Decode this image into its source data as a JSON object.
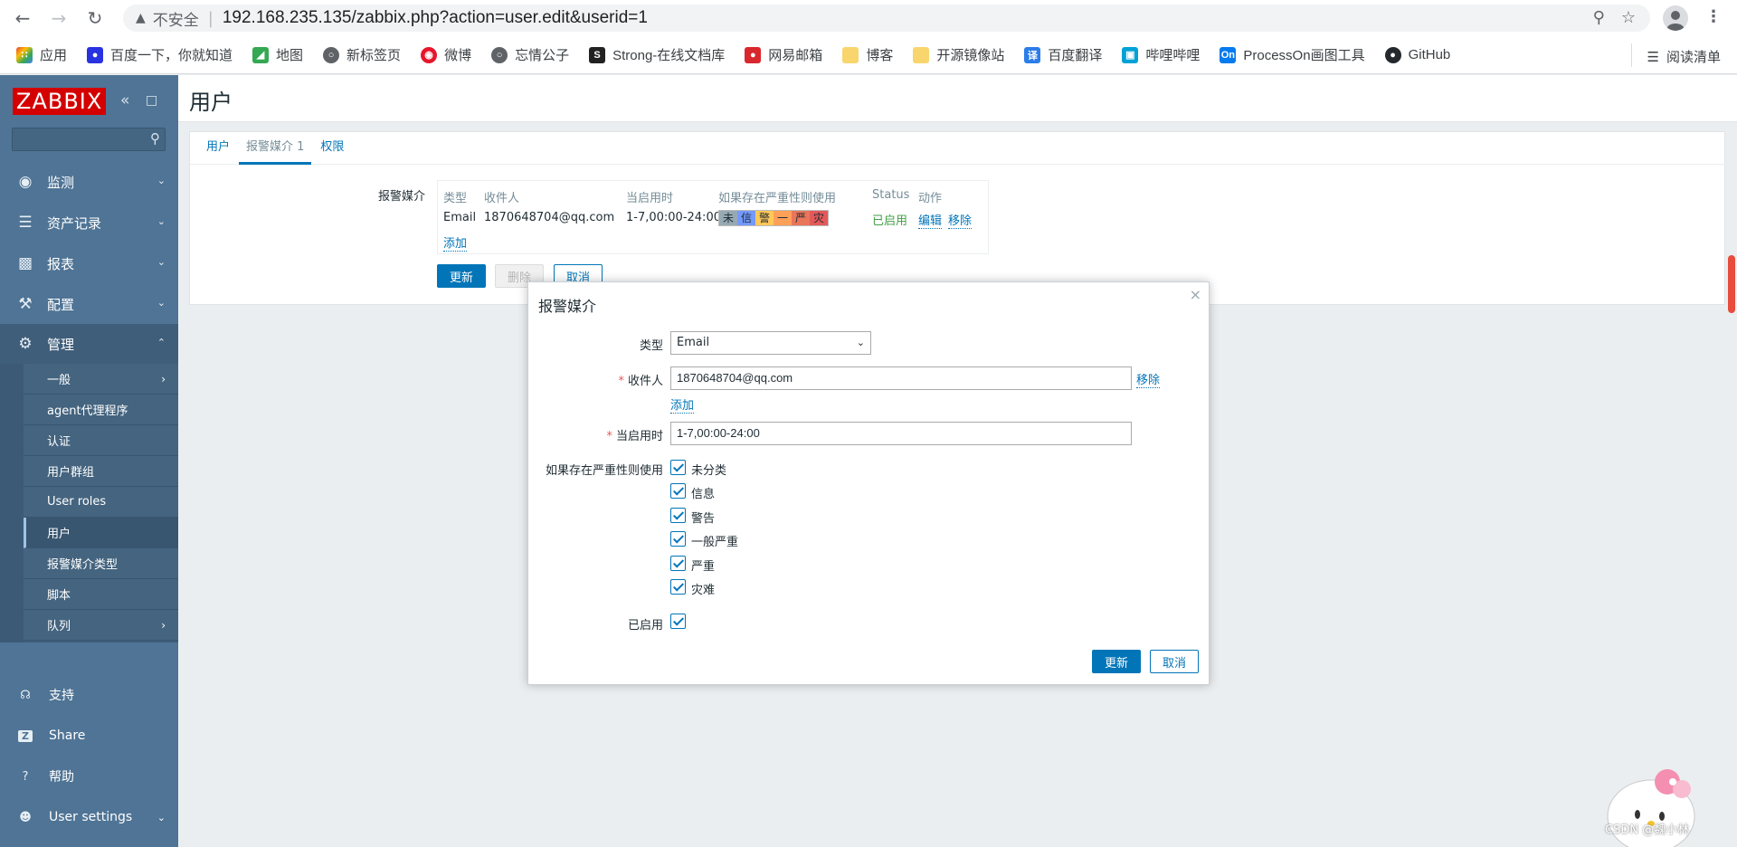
{
  "browser": {
    "insecure_label": "不安全",
    "url": "192.168.235.135/zabbix.php?action=user.edit&userid=1",
    "bookmarks": [
      "应用",
      "百度一下，你就知道",
      "地图",
      "新标签页",
      "微博",
      "忘情公子",
      "Strong-在线文档库",
      "网易邮箱",
      "博客",
      "开源镜像站",
      "百度翻译",
      "哔哩哔哩",
      "ProcessOn画图工具",
      "GitHub"
    ],
    "reading_list": "阅读清单"
  },
  "sidebar": {
    "logo": "ZABBIX",
    "menu": [
      "监测",
      "资产记录",
      "报表",
      "配置",
      "管理"
    ],
    "submenu": [
      "一般",
      "agent代理程序",
      "认证",
      "用户群组",
      "User roles",
      "用户",
      "报警媒介类型",
      "脚本",
      "队列"
    ],
    "bottom": [
      "支持",
      "Share",
      "帮助",
      "User settings"
    ]
  },
  "page": {
    "title": "用户",
    "tabs": [
      "用户",
      "报警媒介 1",
      "权限"
    ],
    "media_label": "报警媒介",
    "table_headers": [
      "类型",
      "收件人",
      "当启用时",
      "如果存在严重性则使用",
      "Status",
      "动作"
    ],
    "row": {
      "type": "Email",
      "recipient": "1870648704@qq.com",
      "when": "1-7,00:00-24:00",
      "severities": [
        "未",
        "信",
        "警",
        "一",
        "严",
        "灾"
      ],
      "status": "已启用",
      "edit": "编辑",
      "remove": "移除"
    },
    "add": "添加",
    "btn_update": "更新",
    "btn_delete": "删除",
    "btn_cancel": "取消"
  },
  "modal": {
    "title": "报警媒介",
    "type_label": "类型",
    "type_value": "Email",
    "recipient_label": "收件人",
    "recipient_value": "1870648704@qq.com",
    "remove": "移除",
    "add": "添加",
    "when_label": "当启用时",
    "when_value": "1-7,00:00-24:00",
    "severity_label": "如果存在严重性则使用",
    "severities": [
      "未分类",
      "信息",
      "警告",
      "一般严重",
      "严重",
      "灾难"
    ],
    "enabled_label": "已启用",
    "btn_update": "更新",
    "btn_cancel": "取消"
  },
  "colors": {
    "sev_colors": [
      "#97aab3",
      "#7499ff",
      "#ffc859",
      "#ffa059",
      "#e97659",
      "#e45959"
    ]
  },
  "watermark": "CSDN @魏小林"
}
